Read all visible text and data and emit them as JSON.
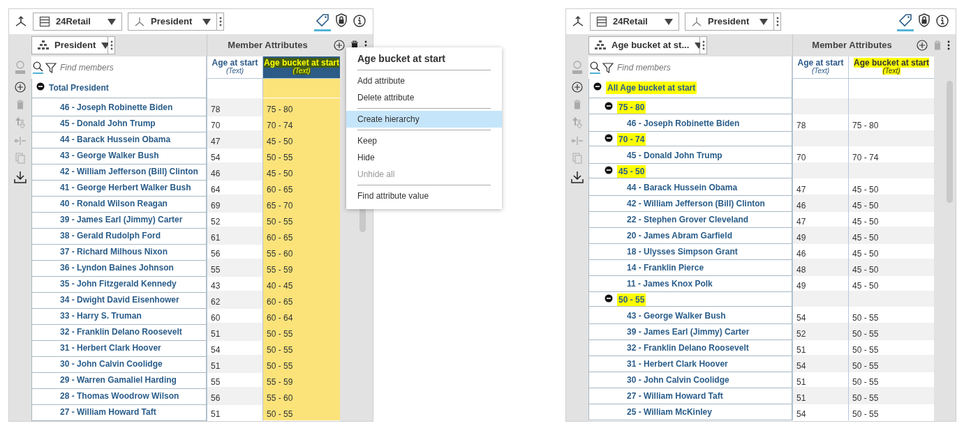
{
  "panels": [
    {
      "cube": "24Retail",
      "dimension": "President",
      "hierarchy": "President",
      "section_title": "Member Attributes",
      "tool_tabs": [
        {
          "kind": "attributes",
          "selected": true
        },
        {
          "kind": "security",
          "selected": false
        },
        {
          "kind": "info",
          "selected": false
        }
      ],
      "search": {
        "placeholder": "Find members"
      },
      "columns": [
        {
          "label": "Age at start",
          "type": "(Text)",
          "selected": false,
          "highlighted": false
        },
        {
          "label": "Age bucket at start",
          "type": "(Text)",
          "selected": true,
          "highlighted": true
        }
      ],
      "rows": [
        {
          "label": "Total President",
          "expanded": true,
          "highlighted": false,
          "children": [
            {
              "label": "46 - Joseph Robinette Biden",
              "values": [
                "78",
                "75 - 80"
              ]
            },
            {
              "label": "45 - Donald John Trump",
              "values": [
                "70",
                "70 - 74"
              ]
            },
            {
              "label": "44 - Barack Hussein Obama",
              "values": [
                "47",
                "45 - 50"
              ]
            },
            {
              "label": "43 - George Walker Bush",
              "values": [
                "54",
                "50 - 55"
              ]
            },
            {
              "label": "42 - William Jefferson (Bill) Clinton",
              "values": [
                "46",
                "45 - 50"
              ]
            },
            {
              "label": "41 - George Herbert Walker Bush",
              "values": [
                "64",
                "60 - 65"
              ]
            },
            {
              "label": "40 - Ronald Wilson Reagan",
              "values": [
                "69",
                "65 - 70"
              ]
            },
            {
              "label": "39 - James Earl (Jimmy) Carter",
              "values": [
                "52",
                "50 - 55"
              ]
            },
            {
              "label": "38 - Gerald Rudolph Ford",
              "values": [
                "61",
                "60 - 65"
              ]
            },
            {
              "label": "37 - Richard Milhous Nixon",
              "values": [
                "56",
                "55 - 60"
              ]
            },
            {
              "label": "36 - Lyndon Baines Johnson",
              "values": [
                "55",
                "55 - 59"
              ]
            },
            {
              "label": "35 - John Fitzgerald Kennedy",
              "values": [
                "43",
                "40 - 45"
              ]
            },
            {
              "label": "34 - Dwight David Eisenhower",
              "values": [
                "62",
                "60 - 65"
              ]
            },
            {
              "label": "33 - Harry S. Truman",
              "values": [
                "60",
                "60 - 64"
              ]
            },
            {
              "label": "32 - Franklin Delano Roosevelt",
              "values": [
                "51",
                "50 - 55"
              ]
            },
            {
              "label": "31 - Herbert Clark Hoover",
              "values": [
                "54",
                "50 - 55"
              ]
            },
            {
              "label": "30 - John Calvin Coolidge",
              "values": [
                "51",
                "50 - 55"
              ]
            },
            {
              "label": "29 - Warren Gamaliel Harding",
              "values": [
                "55",
                "55 - 59"
              ]
            },
            {
              "label": "28 - Thomas Woodrow Wilson",
              "values": [
                "56",
                "55 - 60"
              ]
            },
            {
              "label": "27 - William Howard Taft",
              "values": [
                "51",
                "50 - 55"
              ]
            }
          ]
        }
      ]
    },
    {
      "cube": "24Retail",
      "dimension": "President",
      "hierarchy": "Age bucket at st...",
      "section_title": "Member Attributes",
      "tool_tabs": [
        {
          "kind": "attributes",
          "selected": true
        },
        {
          "kind": "security",
          "selected": false
        },
        {
          "kind": "info",
          "selected": false
        }
      ],
      "search": {
        "placeholder": "Find members"
      },
      "columns": [
        {
          "label": "Age at start",
          "type": "(Text)",
          "selected": false,
          "highlighted": false
        },
        {
          "label": "Age bucket at start",
          "type": "(Text)",
          "selected": false,
          "highlighted": true
        }
      ],
      "rows": [
        {
          "label": "All Age bucket at start",
          "expanded": true,
          "highlighted": true,
          "children": [
            {
              "label": "75 - 80",
              "expanded": true,
              "highlighted": true,
              "children": [
                {
                  "label": "46 - Joseph Robinette Biden",
                  "values": [
                    "78",
                    "75 - 80"
                  ]
                }
              ]
            },
            {
              "label": "70 - 74",
              "expanded": true,
              "highlighted": true,
              "children": [
                {
                  "label": "45 - Donald John Trump",
                  "values": [
                    "70",
                    "70 - 74"
                  ]
                }
              ]
            },
            {
              "label": "45 - 50",
              "expanded": true,
              "highlighted": true,
              "children": [
                {
                  "label": "44 - Barack Hussein Obama",
                  "values": [
                    "47",
                    "45 - 50"
                  ]
                },
                {
                  "label": "42 - William Jefferson (Bill) Clinton",
                  "values": [
                    "46",
                    "45 - 50"
                  ]
                },
                {
                  "label": "22 - Stephen Grover Cleveland",
                  "values": [
                    "47",
                    "45 - 50"
                  ]
                },
                {
                  "label": "20 - James Abram Garfield",
                  "values": [
                    "49",
                    "45 - 50"
                  ]
                },
                {
                  "label": "18 - Ulysses Simpson Grant",
                  "values": [
                    "46",
                    "45 - 50"
                  ]
                },
                {
                  "label": "14 - Franklin Pierce",
                  "values": [
                    "48",
                    "45 - 50"
                  ]
                },
                {
                  "label": "11 - James Knox Polk",
                  "values": [
                    "49",
                    "45 - 50"
                  ]
                }
              ]
            },
            {
              "label": "50 - 55",
              "expanded": true,
              "highlighted": true,
              "children": [
                {
                  "label": "43 - George Walker Bush",
                  "values": [
                    "54",
                    "50 - 55"
                  ]
                },
                {
                  "label": "39 - James Earl (Jimmy) Carter",
                  "values": [
                    "52",
                    "50 - 55"
                  ]
                },
                {
                  "label": "32 - Franklin Delano Roosevelt",
                  "values": [
                    "51",
                    "50 - 55"
                  ]
                },
                {
                  "label": "31 - Herbert Clark Hoover",
                  "values": [
                    "54",
                    "50 - 55"
                  ]
                },
                {
                  "label": "30 - John Calvin Coolidge",
                  "values": [
                    "51",
                    "50 - 55"
                  ]
                },
                {
                  "label": "27 - William Howard Taft",
                  "values": [
                    "51",
                    "50 - 55"
                  ]
                },
                {
                  "label": "25 - William McKinley",
                  "values": [
                    "54",
                    "50 - 55"
                  ]
                }
              ]
            }
          ]
        }
      ]
    }
  ],
  "context_menu": {
    "title": "Age bucket at start",
    "groups": [
      [
        {
          "label": "Add attribute",
          "selected": false,
          "disabled": false
        },
        {
          "label": "Delete attribute",
          "selected": false,
          "disabled": false
        }
      ],
      [
        {
          "label": "Create hierarchy",
          "selected": true,
          "disabled": false
        }
      ],
      [
        {
          "label": "Keep",
          "selected": false,
          "disabled": false
        },
        {
          "label": "Hide",
          "selected": false,
          "disabled": false
        },
        {
          "label": "Unhide all",
          "selected": false,
          "disabled": true
        }
      ],
      [
        {
          "label": "Find attribute value",
          "selected": false,
          "disabled": false
        }
      ]
    ]
  }
}
